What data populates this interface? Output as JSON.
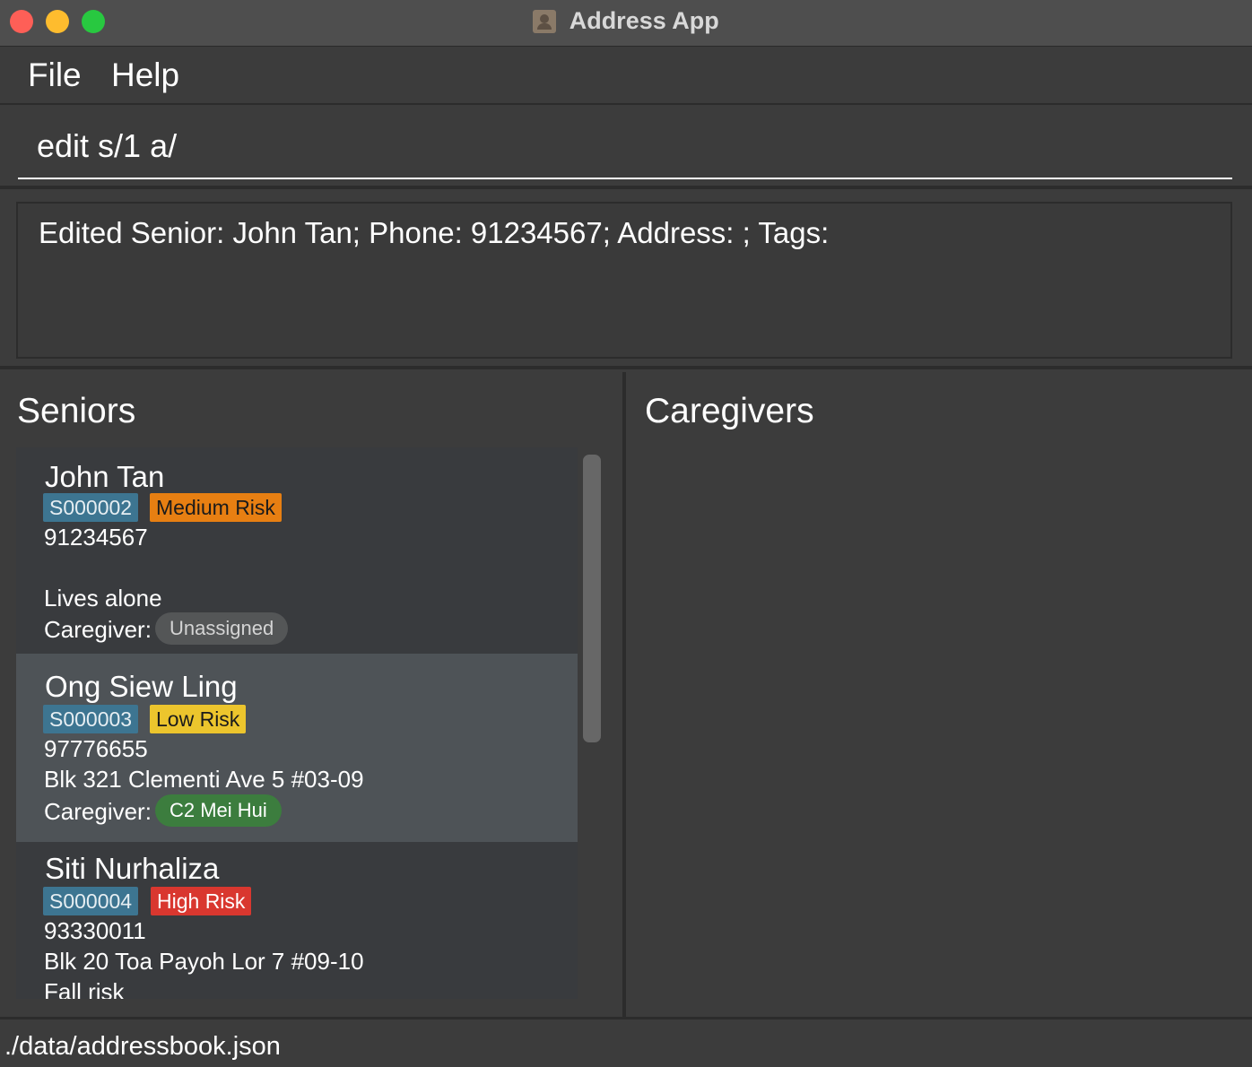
{
  "window": {
    "title": "Address App",
    "icon": "address-book-icon"
  },
  "menu": {
    "file": "File",
    "help": "Help"
  },
  "command": {
    "value": "edit s/1 a/"
  },
  "result": {
    "text": "Edited Senior: John Tan; Phone: 91234567; Address: ; Tags:"
  },
  "seniors": {
    "title": "Seniors",
    "caregiver_label": "Caregiver:",
    "items": [
      {
        "name": "John Tan",
        "id": "S000002",
        "risk": "Medium Risk",
        "phone": "91234567",
        "address": "",
        "note": "Lives alone",
        "caregiver": "Unassigned"
      },
      {
        "name": "Ong Siew Ling",
        "id": "S000003",
        "risk": "Low Risk",
        "phone": "97776655",
        "address": "Blk 321 Clementi Ave 5 #03-09",
        "caregiver": "C2 Mei Hui"
      },
      {
        "name": "Siti Nurhaliza",
        "id": "S000004",
        "risk": "High Risk",
        "phone": "93330011",
        "address": "Blk 20 Toa Payoh Lor 7 #09-10",
        "note": "Fall risk"
      }
    ]
  },
  "caregivers": {
    "title": "Caregivers"
  },
  "status": {
    "path": "./data/addressbook.json"
  },
  "colors": {
    "id_badge": "#3d7591",
    "medium_risk": "#e77f12",
    "low_risk": "#ecc52d",
    "high_risk": "#d9372f",
    "assigned_pill": "#3c7d3e",
    "unassigned_pill": "#545657",
    "selected_card": "#4e5357"
  }
}
